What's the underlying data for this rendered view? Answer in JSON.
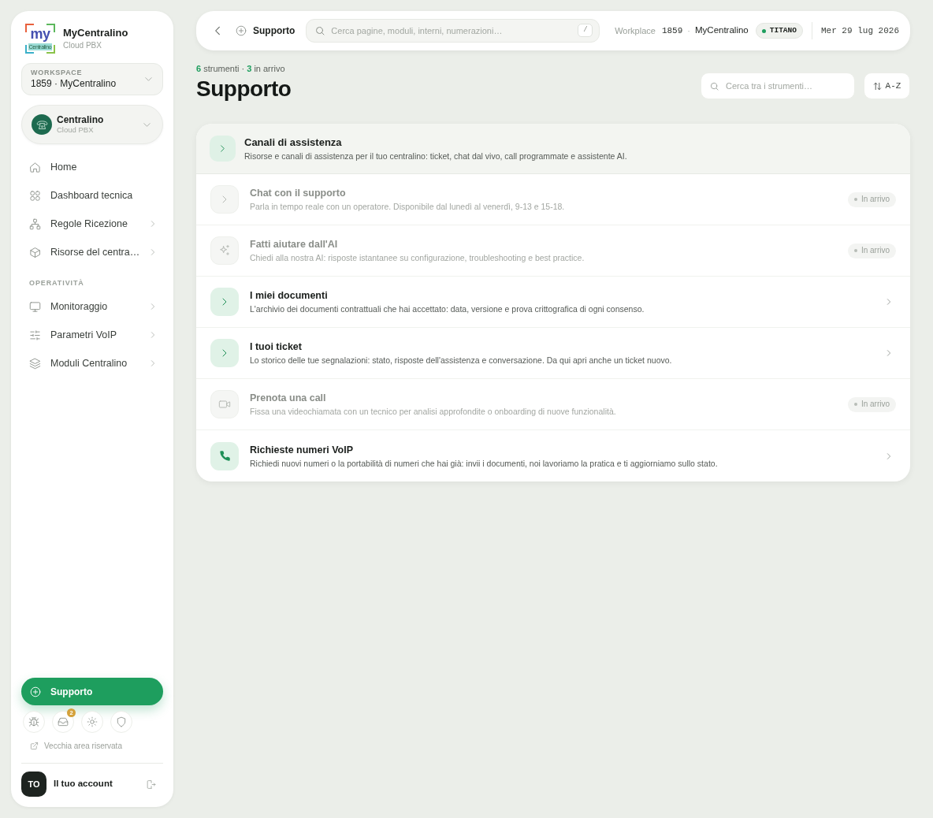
{
  "sidebar": {
    "brand": {
      "logo_text": "my",
      "logo_caption": "Centralino",
      "name": "MyCentralino",
      "subtitle": "Cloud PBX"
    },
    "workspace": {
      "label": "WORKSPACE",
      "value": "1859 · MyCentralino"
    },
    "centralino": {
      "name": "Centralino",
      "subtitle": "Cloud PBX"
    },
    "nav_groups": [
      {
        "items": [
          {
            "label": "Home",
            "submenu": false,
            "selected": false
          },
          {
            "label": "Dashboard tecnica",
            "submenu": false,
            "selected": false
          },
          {
            "label": "Regole Ricezione",
            "submenu": true,
            "selected": false
          },
          {
            "label": "Risorse del centra…",
            "submenu": true,
            "selected": false
          }
        ]
      },
      {
        "title": "OPERATIVITÀ",
        "items": [
          {
            "label": "Monitoraggio",
            "submenu": true,
            "selected": false
          },
          {
            "label": "Parametri VoIP",
            "submenu": true,
            "selected": false
          },
          {
            "label": "Moduli Centralino",
            "submenu": true,
            "selected": false
          }
        ]
      }
    ],
    "support_button": {
      "label": "Supporto",
      "selected": true
    },
    "inbox_count": "2",
    "legacy_link": "Vecchia area riservata",
    "account": {
      "initials": "TO",
      "label": "Il tuo account"
    }
  },
  "topbar": {
    "breadcrumb": "Supporto",
    "search_placeholder": "Cerca pagine, moduli, interni, numerazioni…",
    "search_shortcut": "/",
    "workplace_label": "Workplace",
    "workplace_number": "1859",
    "separator": "·",
    "workplace_name": "MyCentralino",
    "plan": "TITANO",
    "date": "Mer 29 lug 2026"
  },
  "page": {
    "summary": {
      "tools_count": "6",
      "tools_label": "strumenti",
      "separator": "·",
      "coming_count": "3",
      "coming_label": "in arrivo"
    },
    "title": "Supporto",
    "tool_search": {
      "placeholder": "Cerca tra i strumenti…"
    },
    "sort_button": "A-Z"
  },
  "tools": {
    "section": {
      "title": "Canali di assistenza",
      "description": "Risorse e canali di assistenza per il tuo centralino: ticket, chat dal vivo, call programmate e assistente AI."
    },
    "items": [
      {
        "title": "Chat con il supporto",
        "description": "Parla in tempo reale con un operatore. Disponibile dal lunedì al venerdì, 9-13 e 15-18.",
        "disabled": true,
        "badge": "In arrivo"
      },
      {
        "title": "Fatti aiutare dall'AI",
        "description": "Chiedi alla nostra AI: risposte istantanee su configurazione, troubleshooting e best practice.",
        "disabled": true,
        "badge": "In arrivo"
      },
      {
        "title": "I miei documenti",
        "description": "L'archivio dei documenti contrattuali che hai accettato: data, versione e prova crittografica di ogni consenso.",
        "disabled": false
      },
      {
        "title": "I tuoi ticket",
        "description": "Lo storico delle tue segnalazioni: stato, risposte dell'assistenza e conversazione. Da qui apri anche un ticket nuovo.",
        "disabled": false
      },
      {
        "title": "Prenota una call",
        "description": "Fissa una videochiamata con un tecnico per analisi approfondite o onboarding di nuove funzionalità.",
        "disabled": true,
        "badge": "In arrivo"
      },
      {
        "title": "Richieste numeri VoIP",
        "description": "Richiedi nuovi numeri o la portabilità di numeri che hai già: invii i documenti, noi lavoriamo la pratica e ti aggiorniamo sullo stato.",
        "disabled": false
      }
    ]
  }
}
